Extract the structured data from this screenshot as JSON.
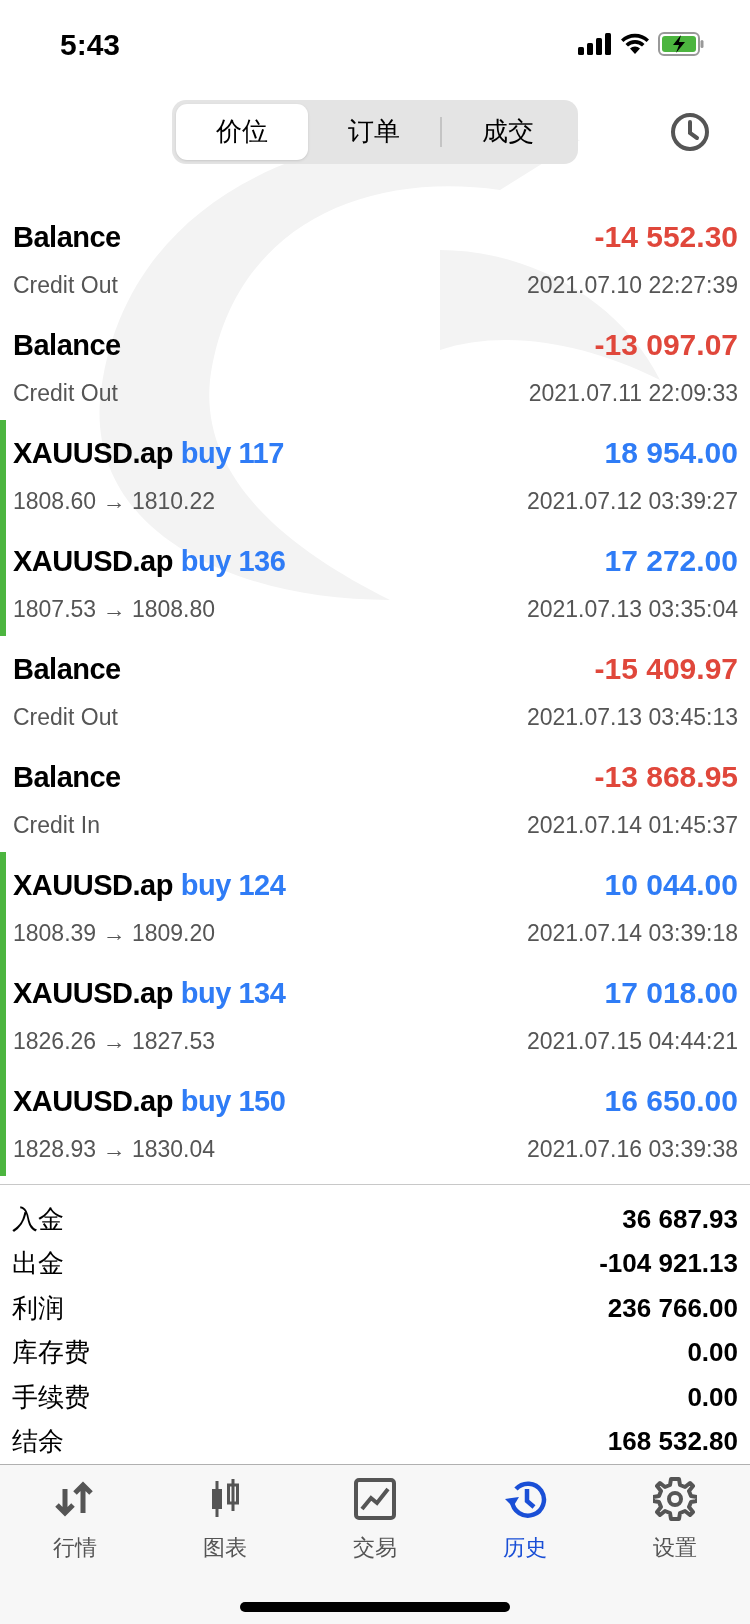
{
  "status_bar": {
    "time": "5:43"
  },
  "segments": [
    {
      "label": "价位",
      "selected": true
    },
    {
      "label": "订单",
      "selected": false
    },
    {
      "label": "成交",
      "selected": false
    }
  ],
  "rows": [
    {
      "kind": "balance",
      "title": "Balance",
      "subtitle": "Credit Out",
      "amount": "-14 552.30",
      "time": "2021.07.10 22:27:39"
    },
    {
      "kind": "balance",
      "title": "Balance",
      "subtitle": "Credit Out",
      "amount": "-13 097.07",
      "time": "2021.07.11 22:09:33"
    },
    {
      "kind": "trade",
      "title": "XAUUSD.ap",
      "action": "buy 117",
      "subtitle": "1808.60 → 1810.22",
      "amount": "18 954.00",
      "time": "2021.07.12 03:39:27"
    },
    {
      "kind": "trade",
      "title": "XAUUSD.ap",
      "action": "buy 136",
      "subtitle": "1807.53 → 1808.80",
      "amount": "17 272.00",
      "time": "2021.07.13 03:35:04"
    },
    {
      "kind": "balance",
      "title": "Balance",
      "subtitle": "Credit Out",
      "amount": "-15 409.97",
      "time": "2021.07.13 03:45:13"
    },
    {
      "kind": "balance",
      "title": "Balance",
      "subtitle": "Credit In",
      "amount": "-13 868.95",
      "time": "2021.07.14 01:45:37"
    },
    {
      "kind": "trade",
      "title": "XAUUSD.ap",
      "action": "buy 124",
      "subtitle": "1808.39 → 1809.20",
      "amount": "10 044.00",
      "time": "2021.07.14 03:39:18"
    },
    {
      "kind": "trade",
      "title": "XAUUSD.ap",
      "action": "buy 134",
      "subtitle": "1826.26 → 1827.53",
      "amount": "17 018.00",
      "time": "2021.07.15 04:44:21"
    },
    {
      "kind": "trade",
      "title": "XAUUSD.ap",
      "action": "buy 150",
      "subtitle": "1828.93 → 1830.04",
      "amount": "16 650.00",
      "time": "2021.07.16 03:39:38"
    }
  ],
  "summary": [
    {
      "label": "入金",
      "value": "36 687.93"
    },
    {
      "label": "出金",
      "value": "-104 921.13"
    },
    {
      "label": "利润",
      "value": "236 766.00"
    },
    {
      "label": "库存费",
      "value": "0.00"
    },
    {
      "label": "手续费",
      "value": "0.00"
    },
    {
      "label": "结余",
      "value": "168 532.80"
    }
  ],
  "tabs": [
    {
      "kind": "quotes",
      "label": "行情",
      "selected": false
    },
    {
      "kind": "chart",
      "label": "图表",
      "selected": false
    },
    {
      "kind": "trade",
      "label": "交易",
      "selected": false
    },
    {
      "kind": "history",
      "label": "历史",
      "selected": true
    },
    {
      "kind": "settings",
      "label": "设置",
      "selected": false
    }
  ]
}
